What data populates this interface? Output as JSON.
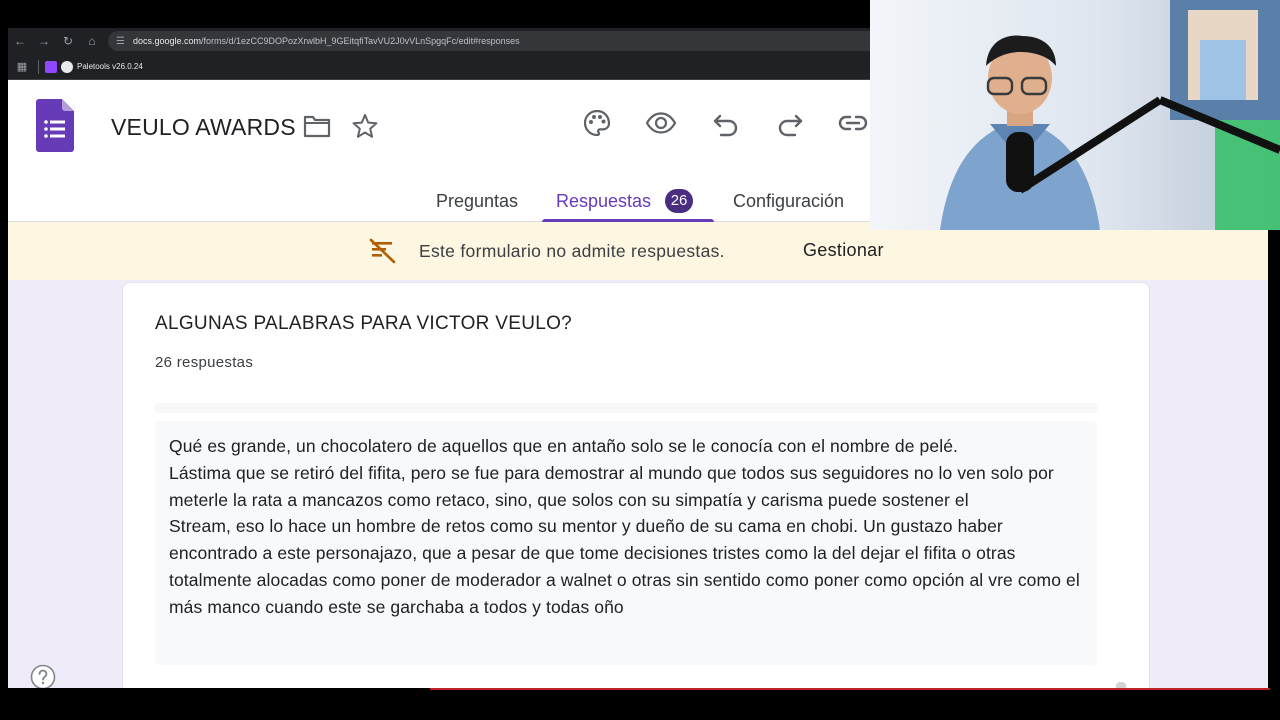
{
  "browser": {
    "url_domain": "docs.google.com",
    "url_path": "/forms/d/1ezCC9DOPozXrwlbH_9GEitqfiTavVU2J0vVLnSpgqFc/edit#responses",
    "bookmark_label": "Paletools v26.0.24"
  },
  "form": {
    "title": "VEULO AWARDS",
    "tabs": {
      "questions": "Preguntas",
      "responses": "Respuestas",
      "responses_count": "26",
      "settings": "Configuración"
    }
  },
  "banner": {
    "message": "Este formulario no admite respuestas.",
    "action": "Gestionar"
  },
  "question": {
    "title": "ALGUNAS PALABRAS PARA VICTOR VEULO?",
    "count": "26 respuestas",
    "answer": "Qué es grande, un chocolatero de aquellos que en antaño solo se le conocía con el nombre de pelé.\nLástima que se retiró del fifita, pero se fue para demostrar al mundo que todos sus seguidores no lo ven solo por meterle la rata a mancazos como retaco, sino, que solos con su simpatía y carisma puede sostener el\nStream, eso lo hace un hombre de retos como su mentor y dueño de su cama en chobi. Un gustazo haber encontrado a este personajazo, que a pesar de que tome decisiones tristes como la del dejar el fifita o otras totalmente alocadas como poner de moderador a walnet o otras sin sentido como poner como opción al vre como el más manco cuando este se garchaba a todos y todas oño"
  },
  "colors": {
    "accent": "#673ab7",
    "badge": "#4a2c80",
    "banner_bg": "#fdf6e0",
    "page_bg": "#f0ebf8"
  },
  "icons": [
    "back-icon",
    "forward-icon",
    "reload-icon",
    "home-icon",
    "site-info-icon",
    "apps-icon",
    "forms-logo-icon",
    "folder-icon",
    "star-icon",
    "palette-icon",
    "preview-eye-icon",
    "undo-icon",
    "redo-icon",
    "link-icon",
    "responses-off-icon",
    "help-icon"
  ]
}
